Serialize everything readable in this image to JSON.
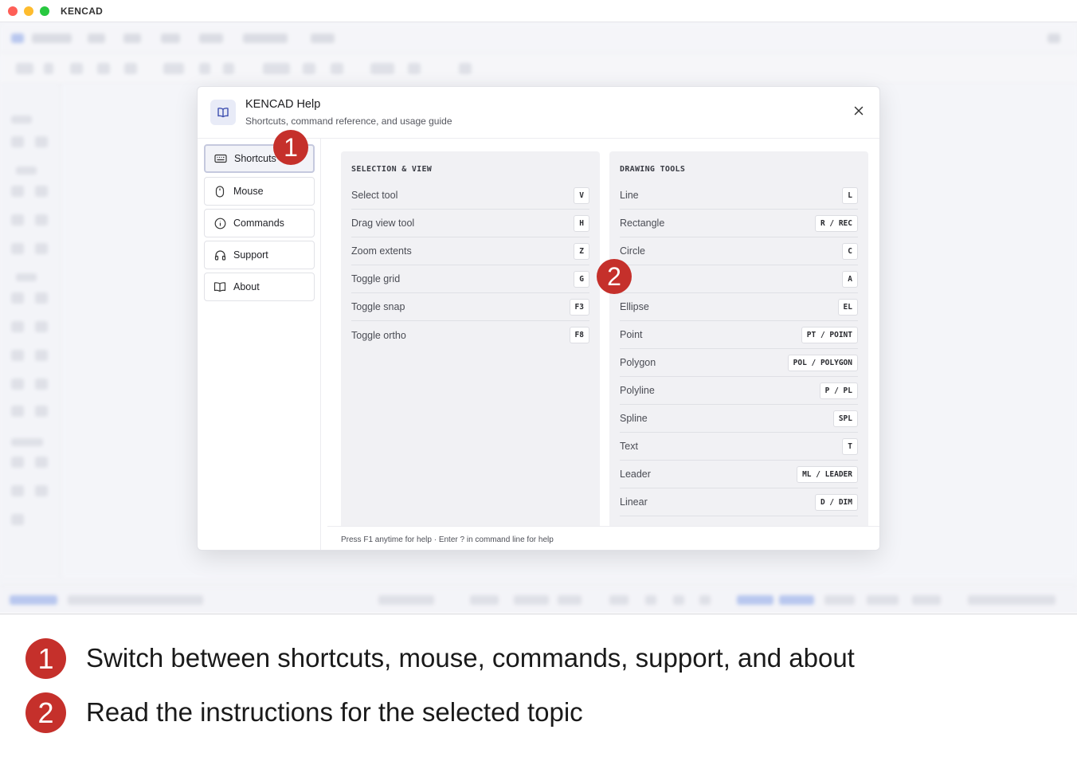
{
  "window": {
    "title": "KENCAD"
  },
  "dialog": {
    "title": "KENCAD Help",
    "subtitle": "Shortcuts, command reference, and usage guide",
    "close_icon": "close-icon",
    "logo_icon": "book-icon"
  },
  "nav": [
    {
      "label": "Shortcuts",
      "icon": "keyboard-icon",
      "active": true
    },
    {
      "label": "Mouse",
      "icon": "mouse-icon",
      "active": false
    },
    {
      "label": "Commands",
      "icon": "info-icon",
      "active": false
    },
    {
      "label": "Support",
      "icon": "headphones-icon",
      "active": false
    },
    {
      "label": "About",
      "icon": "book-icon",
      "active": false
    }
  ],
  "sections": {
    "selection_view": {
      "title": "SELECTION & VIEW",
      "rows": [
        {
          "name": "Select tool",
          "key": "V"
        },
        {
          "name": "Drag view tool",
          "key": "H"
        },
        {
          "name": "Zoom extents",
          "key": "Z"
        },
        {
          "name": "Toggle grid",
          "key": "G"
        },
        {
          "name": "Toggle snap",
          "key": "F3"
        },
        {
          "name": "Toggle ortho",
          "key": "F8"
        }
      ]
    },
    "drawing_tools": {
      "title": "DRAWING TOOLS",
      "rows": [
        {
          "name": "Line",
          "key": "L"
        },
        {
          "name": "Rectangle",
          "key": "R / REC"
        },
        {
          "name": "Circle",
          "key": "C"
        },
        {
          "name": "",
          "key": "A"
        },
        {
          "name": "Ellipse",
          "key": "EL"
        },
        {
          "name": "Point",
          "key": "PT / POINT"
        },
        {
          "name": "Polygon",
          "key": "POL / POLYGON"
        },
        {
          "name": "Polyline",
          "key": "P / PL"
        },
        {
          "name": "Spline",
          "key": "SPL"
        },
        {
          "name": "Text",
          "key": "T"
        },
        {
          "name": "Leader",
          "key": "ML / LEADER"
        },
        {
          "name": "Linear",
          "key": "D / DIM"
        }
      ]
    }
  },
  "footer": {
    "text": "Press F1 anytime for help · Enter ? in command line for help"
  },
  "markers": {
    "one": "1",
    "two": "2"
  },
  "legend": [
    {
      "number": "1",
      "text": "Switch between shortcuts, mouse, commands, support, and about"
    },
    {
      "number": "2",
      "text": "Read the instructions for the selected topic"
    }
  ],
  "colors": {
    "marker": "#c5302b",
    "accent": "#8aa4e8"
  }
}
